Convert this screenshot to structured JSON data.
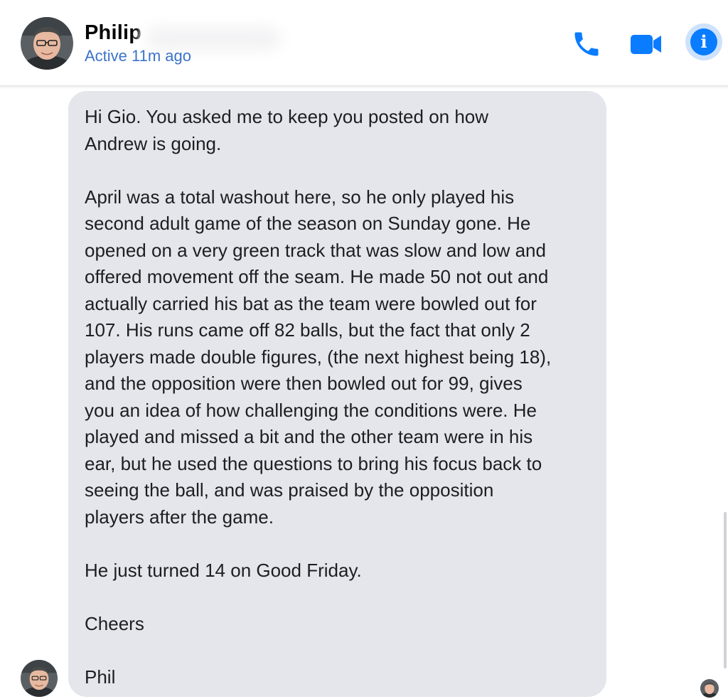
{
  "contact": {
    "name": "Philip",
    "status": "Active 11m ago"
  },
  "header": {
    "icons": [
      "phone-icon",
      "video-camera-icon",
      "info-icon"
    ],
    "info_glyph": "i",
    "accent": "#0a7cff"
  },
  "message": {
    "paragraphs": [
      "Hi Gio. You asked me to keep you posted on how\nAndrew is going.",
      "April was a total washout here, so he only played his\nsecond adult game of the season on Sunday gone. He\nopened on a very green track that was slow and low and\noffered movement off the seam. He made 50 not out and\nactually carried his bat as the team were bowled out for\n107. His runs came off 82 balls, but the fact that only 2\nplayers made double figures, (the next highest being 18),\nand the opposition were then bowled out for 99, gives\nyou an idea of how challenging the conditions were. He\nplayed and missed a bit and the other team were in his\near, but he used the questions to bring his focus back to\nseeing the ball, and was praised by the opposition\nplayers after the game.",
      "He just turned 14 on Good Friday.",
      "Cheers",
      "Phil"
    ],
    "bubble_color": "#e4e6eb"
  }
}
